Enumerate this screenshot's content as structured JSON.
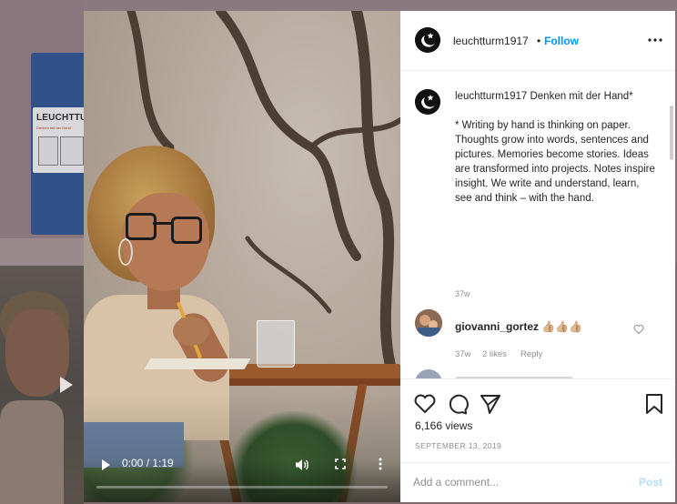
{
  "background": {
    "notebook_brand": "LEUCHTTUR",
    "notebook_tagline": "Denken mit der Hand"
  },
  "video": {
    "time": "0:00 / 1:19",
    "progress": 0.0,
    "controls": {
      "play_icon": "play-icon",
      "volume_icon": "volume-icon",
      "fullscreen_icon": "fullscreen-icon",
      "more_icon": "more-vertical-icon"
    }
  },
  "post": {
    "username": "leuchtturm1917",
    "separator": "•",
    "follow_label": "Follow",
    "more_icon": "more-horizontal-icon",
    "caption": {
      "username": "leuchtturm1917",
      "title": " Denken mit der Hand*",
      "lines": [
        "* Writing by hand is thinking on paper.",
        "Thoughts grow into words, sentences and pictures. Memories become stories. Ideas are transformed into projects. Notes inspire insight. We write and understand, learn, see and think – with the hand."
      ],
      "time": "37w"
    },
    "comments": [
      {
        "username": "giovanni_gortez",
        "text": "👍🏼👍🏼👍🏼",
        "time": "37w",
        "likes": "2 likes",
        "reply_label": "Reply"
      }
    ],
    "views": "6,166 views",
    "date": "SEPTEMBER 13, 2019",
    "comment_box": {
      "placeholder": "Add a comment...",
      "post_label": "Post"
    }
  },
  "colors": {
    "link_blue": "#0095f6",
    "post_disabled": "#b2dffc",
    "muted": "#8e8e8e",
    "text": "#262626"
  }
}
